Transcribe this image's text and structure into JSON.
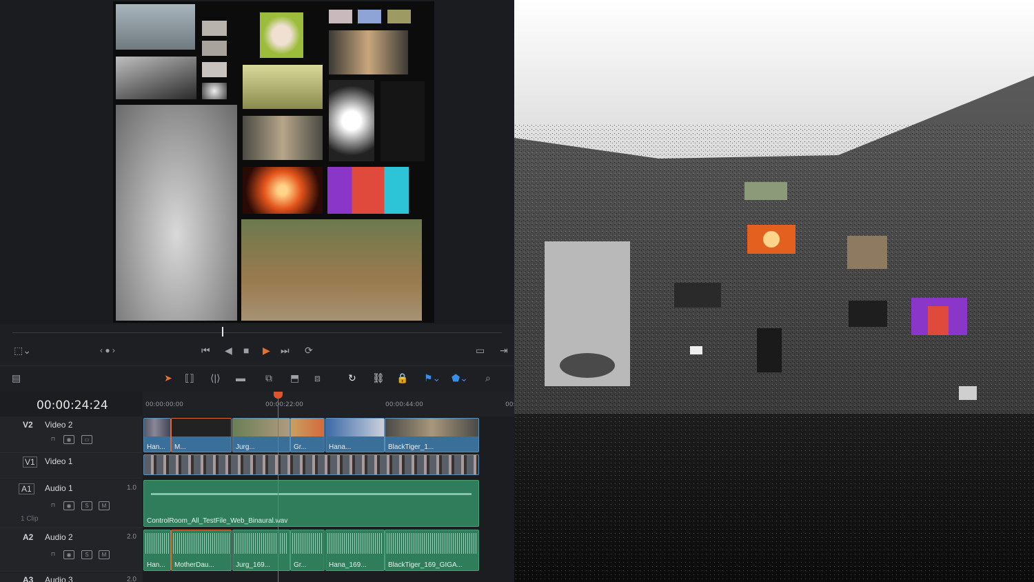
{
  "timecode": "00:00:24:24",
  "ruler": {
    "t0": "00:00:00:00",
    "t1": "00:00:22:00",
    "t2": "00:00:44:00",
    "t3": "00:"
  },
  "tracks": {
    "v2": {
      "id": "V2",
      "name": "Video 2"
    },
    "v1": {
      "id": "V1",
      "name": "Video 1"
    },
    "a1": {
      "id": "A1",
      "name": "Audio 1",
      "level": "1.0",
      "clip_count": "1 Clip"
    },
    "a2": {
      "id": "A2",
      "name": "Audio 2",
      "level": "2.0"
    },
    "a3": {
      "id": "A3",
      "name": "Audio 3",
      "level": "2.0"
    }
  },
  "v2_clips": [
    "Han...",
    "M...",
    "Jurg...",
    "Gr...",
    "Hana...",
    "BlackTiger_1..."
  ],
  "a1_clip": "ControlRoom_All_TestFile_Web_Binaural.wav",
  "a2_clips": [
    "Han...",
    "MotherDau...",
    "Jurg_169...",
    "Gr...",
    "Hana_169...",
    "BlackTiger_169_GIGA..."
  ],
  "buttons": {
    "solo": "S",
    "mute": "M"
  },
  "colors": {
    "accent": "#e0532b",
    "video_clip": "#3a6f9a",
    "audio_clip": "#2f7d5a",
    "panel": "#1f2023"
  },
  "icons": [
    "crop-icon",
    "go-to-start-icon",
    "play-reverse-icon",
    "stop-icon",
    "play-icon",
    "go-to-end-icon",
    "loop-icon",
    "selection-tool-icon",
    "trim-tool-icon",
    "blade-tool-icon",
    "snapping-icon",
    "link-icon",
    "lock-icon",
    "flag-icon",
    "marker-icon",
    "zoom-icon"
  ]
}
